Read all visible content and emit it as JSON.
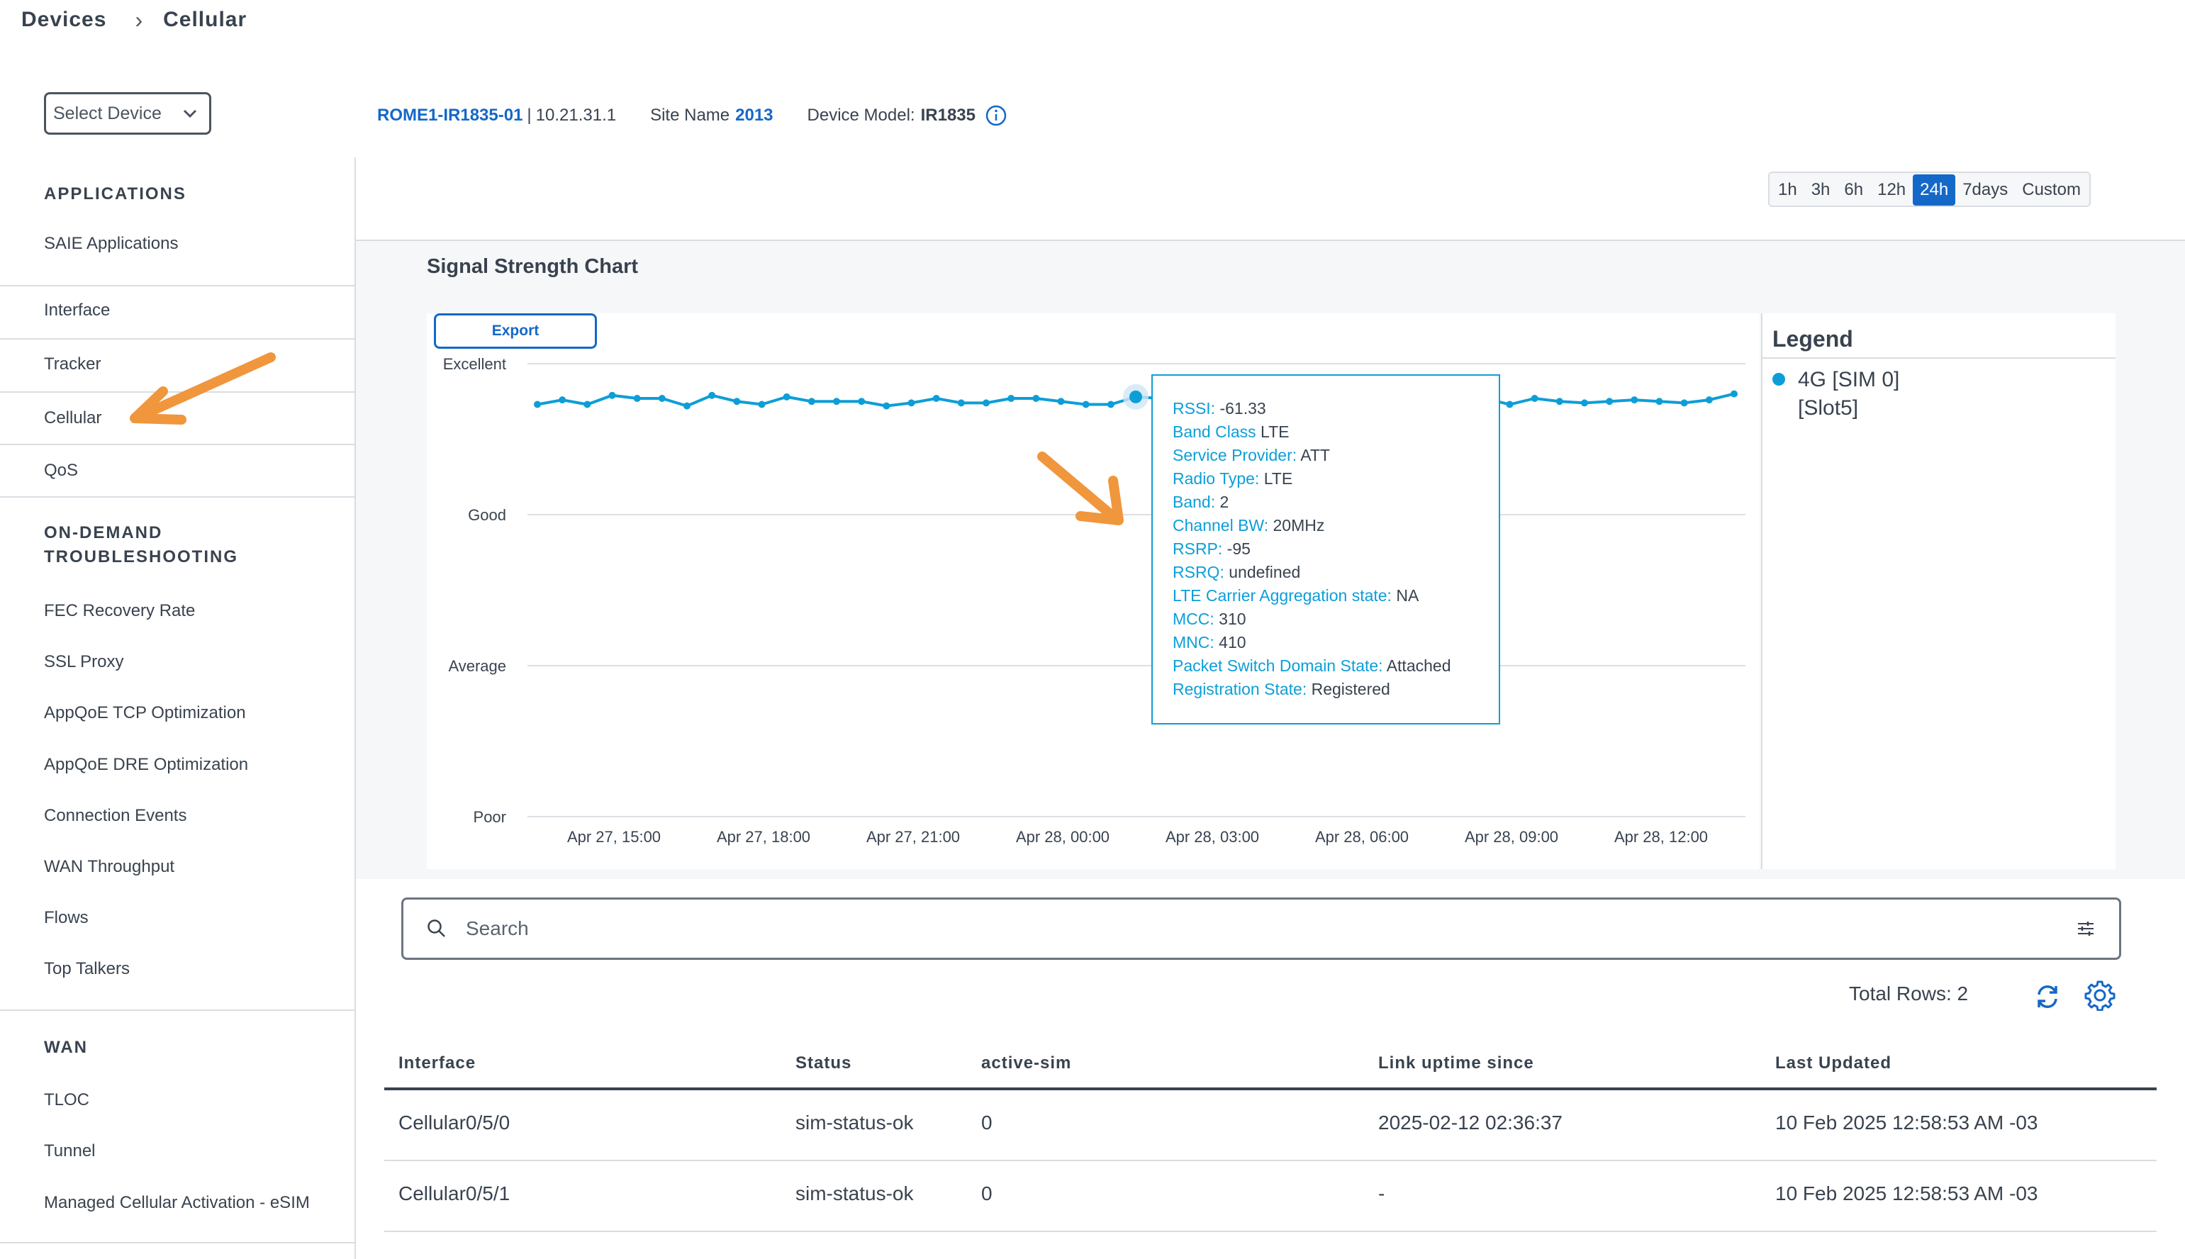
{
  "breadcrumb": {
    "parent": "Devices",
    "current": "Cellular"
  },
  "select_device": {
    "label": "Select Device"
  },
  "device_info": {
    "hostname": "ROME1-IR1835-01",
    "ip": "10.21.31.1",
    "site_label": "Site Name",
    "site_value": "2013",
    "model_label": "Device Model:",
    "model_value": "IR1835"
  },
  "sidebar": {
    "applications_title": "APPLICATIONS",
    "applications": [
      "SAIE Applications"
    ],
    "items": [
      "Interface",
      "Tracker",
      "Cellular",
      "QoS"
    ],
    "troubleshooting_title_1": "ON-DEMAND",
    "troubleshooting_title_2": "TROUBLESHOOTING",
    "troubleshooting": [
      "FEC Recovery Rate",
      "SSL Proxy",
      "AppQoE TCP Optimization",
      "AppQoE DRE Optimization",
      "Connection Events",
      "WAN Throughput",
      "Flows",
      "Top Talkers"
    ],
    "wan_title": "WAN",
    "wan": [
      "TLOC",
      "Tunnel",
      "Managed Cellular Activation - eSIM"
    ]
  },
  "time_range": {
    "options": [
      "1h",
      "3h",
      "6h",
      "12h",
      "24h",
      "7days",
      "Custom"
    ],
    "selected": "24h"
  },
  "chart": {
    "title": "Signal Strength Chart",
    "export_label": "Export",
    "legend_title": "Legend"
  },
  "chart_data": {
    "type": "line",
    "title": "Signal Strength Chart",
    "y_categories": [
      "Poor",
      "Average",
      "Good",
      "Excellent"
    ],
    "x_ticks": [
      "Apr 27, 15:00",
      "Apr 27, 18:00",
      "Apr 27, 21:00",
      "Apr 28, 00:00",
      "Apr 28, 03:00",
      "Apr 28, 06:00",
      "Apr 28, 09:00",
      "Apr 28, 12:00"
    ],
    "series": [
      {
        "name": "4G [SIM 0] [Slot5]",
        "color": "#0d9ed8",
        "values": [
          2.73,
          2.76,
          2.73,
          2.79,
          2.77,
          2.77,
          2.72,
          2.79,
          2.75,
          2.73,
          2.78,
          2.75,
          2.75,
          2.75,
          2.72,
          2.74,
          2.77,
          2.74,
          2.74,
          2.77,
          2.77,
          2.75,
          2.73,
          2.73,
          2.78,
          2.77,
          2.8,
          2.74,
          2.77,
          2.75,
          2.75,
          2.74,
          2.75,
          2.74,
          2.75,
          2.75,
          2.75,
          2.75,
          2.77,
          2.73,
          2.77,
          2.75,
          2.74,
          2.75,
          2.76,
          2.75,
          2.74,
          2.76,
          2.8
        ],
        "highlighted_index": 24
      }
    ],
    "legend_position": "right",
    "grid": true
  },
  "tooltip": [
    {
      "key": "RSSI:",
      "value": "-61.33"
    },
    {
      "key": "Band Class",
      "value": "LTE"
    },
    {
      "key": "Service Provider:",
      "value": "ATT"
    },
    {
      "key": "Radio Type:",
      "value": "LTE"
    },
    {
      "key": "Band:",
      "value": "2"
    },
    {
      "key": "Channel BW:",
      "value": "20MHz"
    },
    {
      "key": "RSRP:",
      "value": "-95"
    },
    {
      "key": "RSRQ:",
      "value": "undefined"
    },
    {
      "key": "LTE Carrier Aggregation state:",
      "value": "NA"
    },
    {
      "key": "MCC:",
      "value": "310"
    },
    {
      "key": "MNC:",
      "value": "410"
    },
    {
      "key": "Packet Switch Domain State:",
      "value": "Attached"
    },
    {
      "key": "Registration State:",
      "value": "Registered"
    }
  ],
  "search": {
    "placeholder": "Search"
  },
  "table": {
    "total_rows": "Total Rows: 2",
    "columns": [
      "Interface",
      "Status",
      "active-sim",
      "Link uptime since",
      "Last Updated"
    ],
    "rows": [
      [
        "Cellular0/5/0",
        "sim-status-ok",
        "0",
        "2025-02-12 02:36:37",
        "10 Feb 2025 12:58:53 AM -03"
      ],
      [
        "Cellular0/5/1",
        "sim-status-ok",
        "0",
        "-",
        "10 Feb 2025 12:58:53 AM -03"
      ]
    ]
  },
  "colors": {
    "accent": "#1468c8",
    "series": "#0d9ed8",
    "annotation": "#f0963c"
  }
}
